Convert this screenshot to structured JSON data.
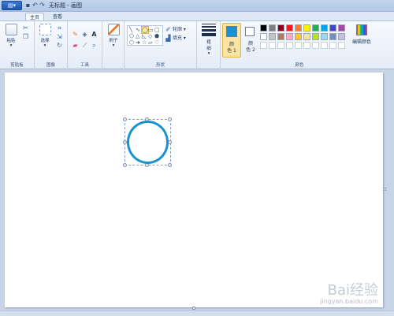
{
  "window": {
    "title": "无标题 - 画图",
    "app_menu_glyph": "▤▾",
    "qat_icons": [
      "save-icon",
      "undo-icon",
      "redo-icon",
      "dropdown-icon"
    ]
  },
  "tabs": [
    {
      "label": "主页",
      "active": true
    },
    {
      "label": "查看",
      "active": false
    }
  ],
  "ribbon": {
    "clipboard": {
      "paste_label": "粘贴",
      "group_label": "剪贴板"
    },
    "image": {
      "select_label": "选择",
      "group_label": "图像"
    },
    "tools": {
      "text_tool_glyph": "A",
      "group_label": "工具"
    },
    "brushes": {
      "label": "刷子"
    },
    "shapes": {
      "outline_label": "轮廓",
      "fill_label": "填充",
      "group_label": "形状"
    },
    "size": {
      "label_line1": "粗",
      "label_line2": "细"
    },
    "colors": {
      "color1_label_line1": "颜",
      "color1_label_line2": "色 1",
      "color2_label_line1": "颜",
      "color2_label_line2": "色 2",
      "edit_colors_label": "编辑颜色",
      "group_label": "颜色",
      "color1_value": "#1a92d0",
      "color2_value": "#ffffff",
      "palette_row1": [
        "#000000",
        "#7f7f7f",
        "#880015",
        "#ed1c24",
        "#ff7f27",
        "#fff200",
        "#22b14c",
        "#00a2e8",
        "#3f48cc",
        "#a349a4"
      ],
      "palette_row2": [
        "#ffffff",
        "#c3c3c3",
        "#b97a57",
        "#ffaec9",
        "#ffc90e",
        "#efe4b0",
        "#b5e61d",
        "#99d9ea",
        "#7092be",
        "#c8bfe7"
      ],
      "palette_row3": [
        "#ffffff",
        "#ffffff",
        "#ffffff",
        "#ffffff",
        "#ffffff",
        "#ffffff",
        "#ffffff",
        "#ffffff",
        "#ffffff",
        "#ffffff"
      ]
    }
  },
  "canvas": {
    "shape": "circle",
    "stroke_color": "#1a92d0"
  },
  "watermark": {
    "logo_text": "Bai经验",
    "url_text": "jingyan.baidu.com"
  }
}
